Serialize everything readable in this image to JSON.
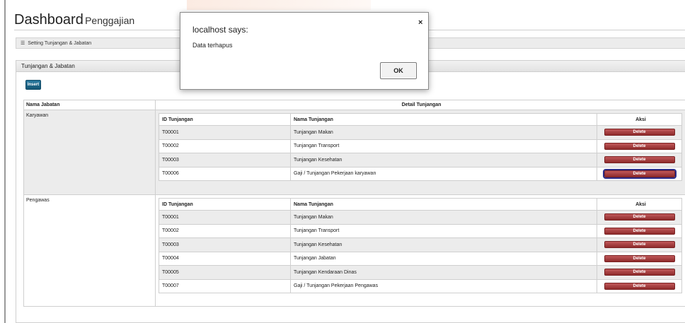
{
  "page": {
    "title_main": "Dashboard",
    "title_sub": "Penggajian"
  },
  "breadcrumb": {
    "icon": "list-icon",
    "icon_glyph": "☰",
    "label": "Setting Tunjangan & Jabatan"
  },
  "panel": {
    "heading": "Tunjangan & Jabatan",
    "insert_label": "Insert",
    "col_jabatan": "Nama Jabatan",
    "col_detail": "Detail Tunjangan"
  },
  "inner_headers": {
    "id": "ID Tunjangan",
    "nama": "Nama Tunjangan",
    "aksi": "Aksi"
  },
  "delete_label": "Delete",
  "groups": [
    {
      "jabatan": "Karyawan",
      "rows": [
        {
          "id": "T00001",
          "nama": "Tunjangan Makan"
        },
        {
          "id": "T00002",
          "nama": "Tunjangan Transport"
        },
        {
          "id": "T00003",
          "nama": "Tunjangan Kesehatan"
        },
        {
          "id": "T00006",
          "nama": "Gaji / Tunjangan Pekerjaan karyawan"
        }
      ]
    },
    {
      "jabatan": "Pengawas",
      "rows": [
        {
          "id": "T00001",
          "nama": "Tunjangan Makan"
        },
        {
          "id": "T00002",
          "nama": "Tunjangan Transport"
        },
        {
          "id": "T00003",
          "nama": "Tunjangan Kesehatan"
        },
        {
          "id": "T00004",
          "nama": "Tunjangan Jabatan"
        },
        {
          "id": "T00005",
          "nama": "Tunjangan Kendaraan Dinas"
        },
        {
          "id": "T00007",
          "nama": "Gaji / Tunjangan Pekerjaan Pengawas"
        }
      ]
    }
  ],
  "dialog": {
    "title": "localhost says:",
    "message": "Data terhapus",
    "ok_label": "OK",
    "close_glyph": "×"
  },
  "colors": {
    "delete_button": "#a84243",
    "insert_button": "#1d6689"
  }
}
